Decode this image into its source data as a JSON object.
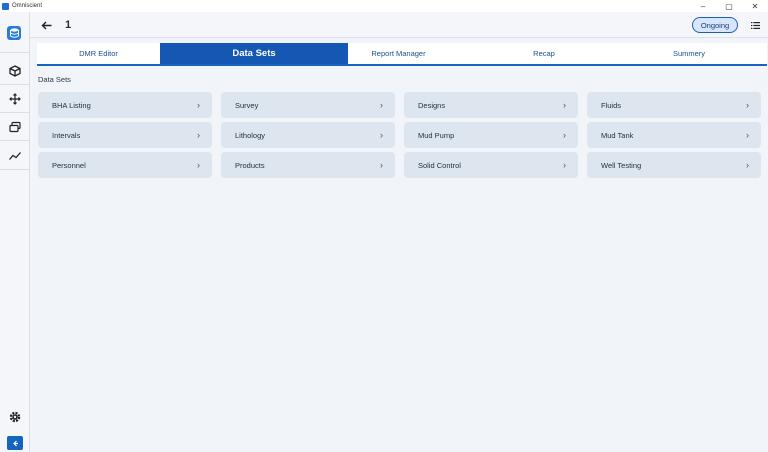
{
  "window": {
    "title": "Omniscient",
    "minimize": "–",
    "restore": "▢",
    "close": "✕"
  },
  "header": {
    "title": "1",
    "status": "Ongoing"
  },
  "tabs": [
    {
      "label": "DMR Editor",
      "active": false
    },
    {
      "label": "Data Sets",
      "active": true
    },
    {
      "label": "Report Manager",
      "active": false
    },
    {
      "label": "Recap",
      "active": false
    },
    {
      "label": "Summery",
      "active": false
    }
  ],
  "section": {
    "title": "Data Sets"
  },
  "datasets": [
    "BHA Listing",
    "Survey",
    "Designs",
    "Fluids",
    "Intervals",
    "Lithology",
    "Mud Pump",
    "Mud Tank",
    "Personnel",
    "Products",
    "Solid Control",
    "Well Testing"
  ],
  "icons": {
    "chevron": "›",
    "sidebar": [
      "cube-icon",
      "move-icon",
      "layers-icon",
      "trend-icon",
      "gear-icon",
      "collapse-icon"
    ]
  },
  "colors": {
    "accent": "#1565c0",
    "card": "#dde6ef",
    "status_fill": "#d7e6fa"
  }
}
